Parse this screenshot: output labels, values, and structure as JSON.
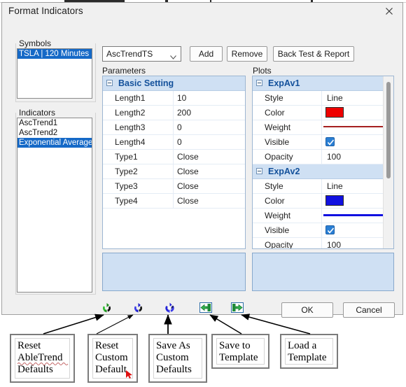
{
  "window": {
    "title": "Format Indicators",
    "close_icon": "close-icon"
  },
  "sidebar": {
    "symbols": {
      "label": "Symbols",
      "items": [
        {
          "label": "TSLA | 120 Minutes",
          "selected": true
        }
      ]
    },
    "indicators": {
      "label": "Indicators",
      "items": [
        {
          "label": "AscTrend1",
          "selected": false
        },
        {
          "label": "AscTrend2",
          "selected": false
        },
        {
          "label": "Exponential Average",
          "selected": true
        }
      ]
    }
  },
  "toolbar": {
    "indicator_select": {
      "value": "AscTrendTS",
      "chevron_icon": "chevron-down-icon"
    },
    "add_label": "Add",
    "remove_label": "Remove",
    "backtest_label": "Back Test & Report"
  },
  "parameters": {
    "panel_label": "Parameters",
    "group": {
      "name": "Basic Setting",
      "expander_icon": "collapse-minus-icon",
      "rows": [
        {
          "name": "Length1",
          "value": "10"
        },
        {
          "name": "Length2",
          "value": "200"
        },
        {
          "name": "Length3",
          "value": "0"
        },
        {
          "name": "Length4",
          "value": "0"
        },
        {
          "name": "Type1",
          "value": "Close"
        },
        {
          "name": "Type2",
          "value": "Close"
        },
        {
          "name": "Type3",
          "value": "Close"
        },
        {
          "name": "Type4",
          "value": "Close"
        }
      ]
    }
  },
  "plots": {
    "panel_label": "Plots",
    "groups": [
      {
        "name": "ExpAv1",
        "expander_icon": "collapse-minus-icon",
        "rows": [
          {
            "name": "Style",
            "kind": "text",
            "value": "Line"
          },
          {
            "name": "Color",
            "kind": "swatch",
            "value": "#ee0000"
          },
          {
            "name": "Weight",
            "kind": "line",
            "value": "#a52020",
            "thickness": 2
          },
          {
            "name": "Visible",
            "kind": "checkbox",
            "value": "checked"
          },
          {
            "name": "Opacity",
            "kind": "text",
            "value": "100"
          }
        ]
      },
      {
        "name": "ExpAv2",
        "expander_icon": "collapse-minus-icon",
        "rows": [
          {
            "name": "Style",
            "kind": "text",
            "value": "Line"
          },
          {
            "name": "Color",
            "kind": "swatch",
            "value": "#1010e0"
          },
          {
            "name": "Weight",
            "kind": "line",
            "value": "#1010e0",
            "thickness": 3
          },
          {
            "name": "Visible",
            "kind": "checkbox",
            "value": "checked"
          },
          {
            "name": "Opacity",
            "kind": "text",
            "value": "100"
          }
        ]
      }
    ],
    "scrollbar": {
      "name": "plots-scrollbar"
    }
  },
  "bottom_toolbar": {
    "icons": [
      {
        "name": "reset-abletrend-defaults-icon",
        "glyph": "recycle-green"
      },
      {
        "name": "reset-custom-default-icon",
        "glyph": "recycle-blue"
      },
      {
        "name": "save-as-custom-defaults-icon",
        "glyph": "recycle-blue-star"
      },
      {
        "name": "save-to-template-icon",
        "glyph": "arrow-left-box-green"
      },
      {
        "name": "load-a-template-icon",
        "glyph": "arrow-right-box-green"
      }
    ],
    "ok_label": "OK",
    "cancel_label": "Cancel"
  },
  "callouts": [
    {
      "name": "callout-reset-abletrend-defaults",
      "lines": [
        "Reset",
        "AbleTrend",
        "Defaults"
      ],
      "squiggle": true
    },
    {
      "name": "callout-reset-custom-default",
      "lines": [
        "Reset",
        "Custom",
        "Default"
      ],
      "cursor": true
    },
    {
      "name": "callout-save-as-custom-defaults",
      "lines": [
        "Save As",
        "Custom",
        "Defaults"
      ]
    },
    {
      "name": "callout-save-to-template",
      "lines": [
        "Save to",
        "Template"
      ]
    },
    {
      "name": "callout-load-a-template",
      "lines": [
        "Load a",
        "Template"
      ]
    }
  ],
  "colors": {
    "selection_blue": "#1569c7",
    "group_header_blue": "#cfe0f3",
    "group_header_text": "#14519b",
    "dialog_bg": "#f0f0f0",
    "red_plot": "#ee0000",
    "blue_plot": "#1010e0"
  }
}
